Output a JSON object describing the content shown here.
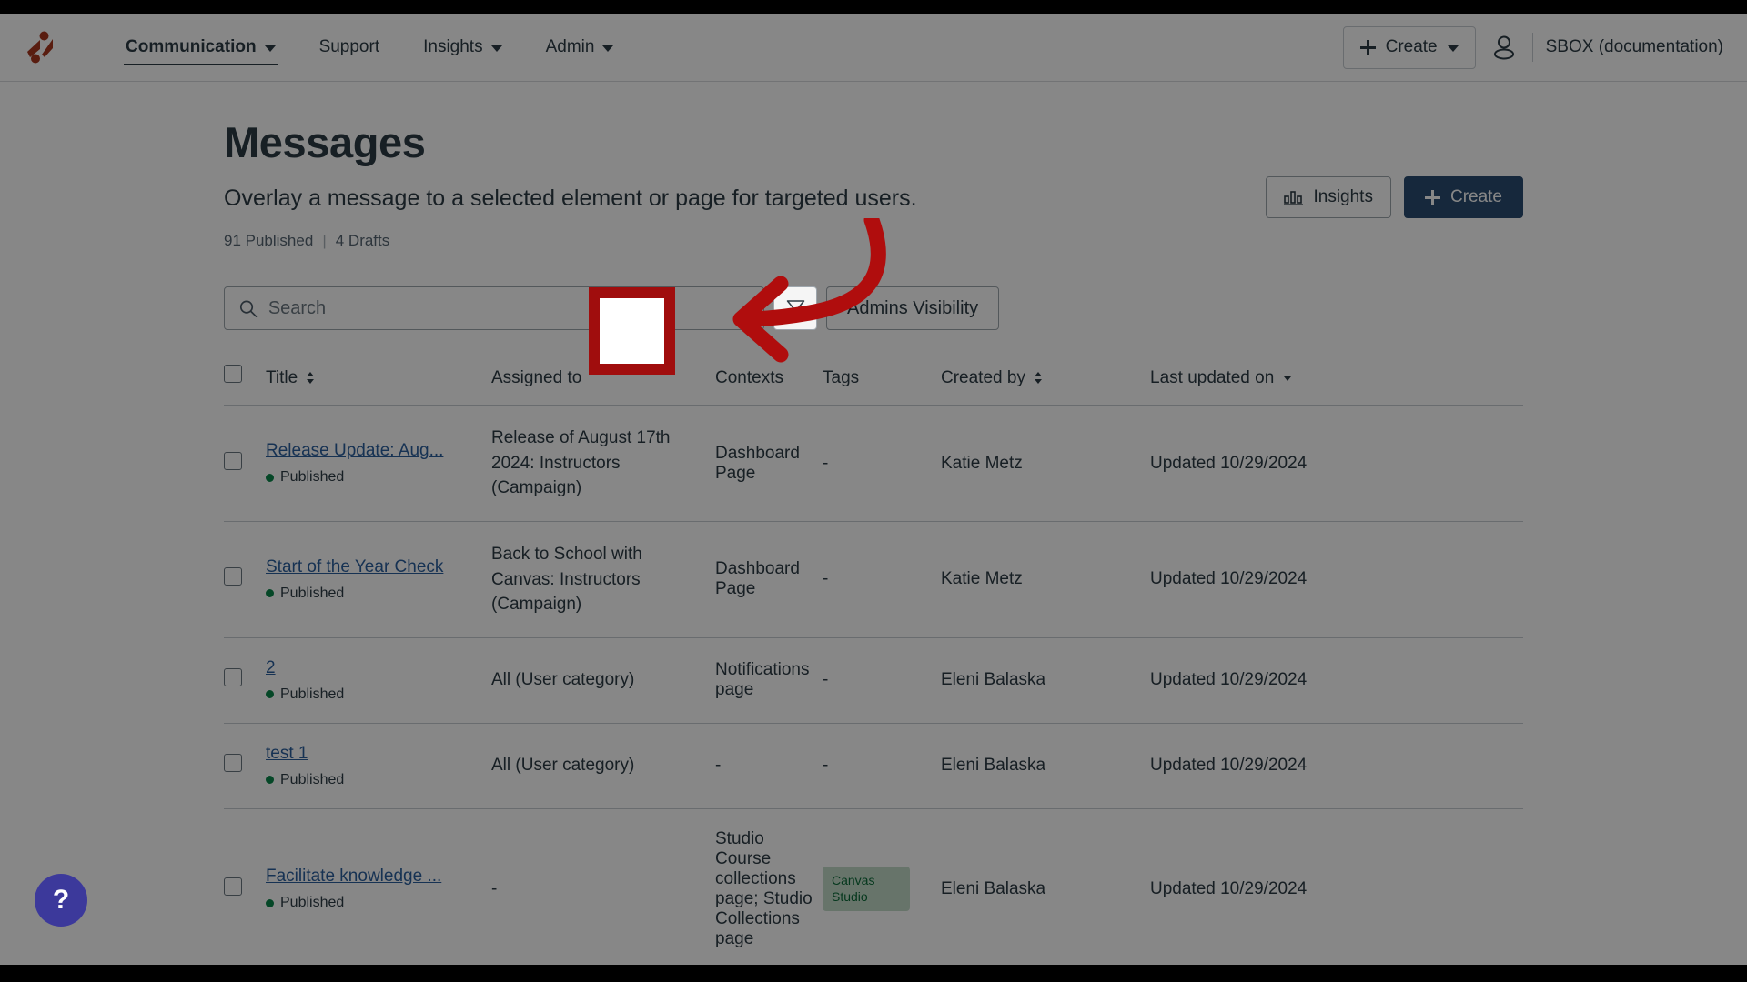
{
  "brand": {
    "logo_icon": "impact-logo-icon",
    "accent": "#a8371f",
    "primary_button": "#2b4d72",
    "highlight_red": "#a00d0d",
    "link_blue": "#2b5f9e",
    "published_green": "#0b874b",
    "fab_purple": "#3c399b"
  },
  "topnav": {
    "items": [
      {
        "label": "Communication",
        "has_caret": true,
        "active": true
      },
      {
        "label": "Support",
        "has_caret": false,
        "active": false
      },
      {
        "label": "Insights",
        "has_caret": true,
        "active": false
      },
      {
        "label": "Admin",
        "has_caret": true,
        "active": false
      }
    ],
    "create_label": "Create",
    "account_name": "SBOX (documentation)",
    "avatar_icon": "user-icon",
    "plus_icon": "plus-icon",
    "caret_icon": "chevron-down-icon"
  },
  "header": {
    "title": "Messages",
    "subtitle": "Overlay a message to a selected element or page for targeted users.",
    "published_count": "91 Published",
    "separator": "|",
    "drafts_count": "4 Drafts",
    "insights_label": "Insights",
    "insights_icon": "bar-chart-icon",
    "create_label": "Create"
  },
  "filterbar": {
    "search_placeholder": "Search",
    "search_value": "",
    "search_icon": "search-icon",
    "filter_icon": "funnel-icon",
    "admins_visibility_label": "Admins Visibility"
  },
  "table": {
    "columns": [
      {
        "key": "check",
        "label": "",
        "sort": "none"
      },
      {
        "key": "title",
        "label": "Title",
        "sort": "both"
      },
      {
        "key": "assigned",
        "label": "Assigned to",
        "sort": "none"
      },
      {
        "key": "contexts",
        "label": "Contexts",
        "sort": "none"
      },
      {
        "key": "tags",
        "label": "Tags",
        "sort": "none"
      },
      {
        "key": "created",
        "label": "Created by",
        "sort": "both"
      },
      {
        "key": "updated",
        "label": "Last updated on",
        "sort": "desc"
      }
    ],
    "select_all_checkbox": false,
    "rows": [
      {
        "title": "Release Update: Aug...",
        "status": "Published",
        "assigned_to": "Release of August 17th 2024: Instructors (Campaign)",
        "contexts": "Dashboard Page",
        "tags": "-",
        "created_by": "Katie Metz",
        "last_updated": "Updated 10/29/2024",
        "checked": false
      },
      {
        "title": "Start of the Year Check",
        "status": "Published",
        "assigned_to": "Back to School with Canvas: Instructors (Campaign)",
        "contexts": "Dashboard Page",
        "tags": "-",
        "created_by": "Katie Metz",
        "last_updated": "Updated 10/29/2024",
        "checked": false
      },
      {
        "title": "2",
        "status": "Published",
        "assigned_to": "All (User category)",
        "contexts": "Notifications page",
        "tags": "-",
        "created_by": "Eleni Balaska",
        "last_updated": "Updated 10/29/2024",
        "checked": false
      },
      {
        "title": "test 1",
        "status": "Published",
        "assigned_to": "All (User category)",
        "contexts": "-",
        "tags": "-",
        "created_by": "Eleni Balaska",
        "last_updated": "Updated 10/29/2024",
        "checked": false
      },
      {
        "title": "Facilitate knowledge ...",
        "status": "Published",
        "assigned_to": "-",
        "contexts": "Studio Course collections page; Studio Collections page",
        "tags": "Canvas Studio",
        "created_by": "Eleni Balaska",
        "last_updated": "Updated 10/29/2024",
        "checked": false
      }
    ]
  },
  "help": {
    "label": "?",
    "icon": "question-mark-icon"
  },
  "annotation": {
    "highlight_target": "filter-button",
    "arrow_icon": "curved-left-arrow-icon"
  }
}
